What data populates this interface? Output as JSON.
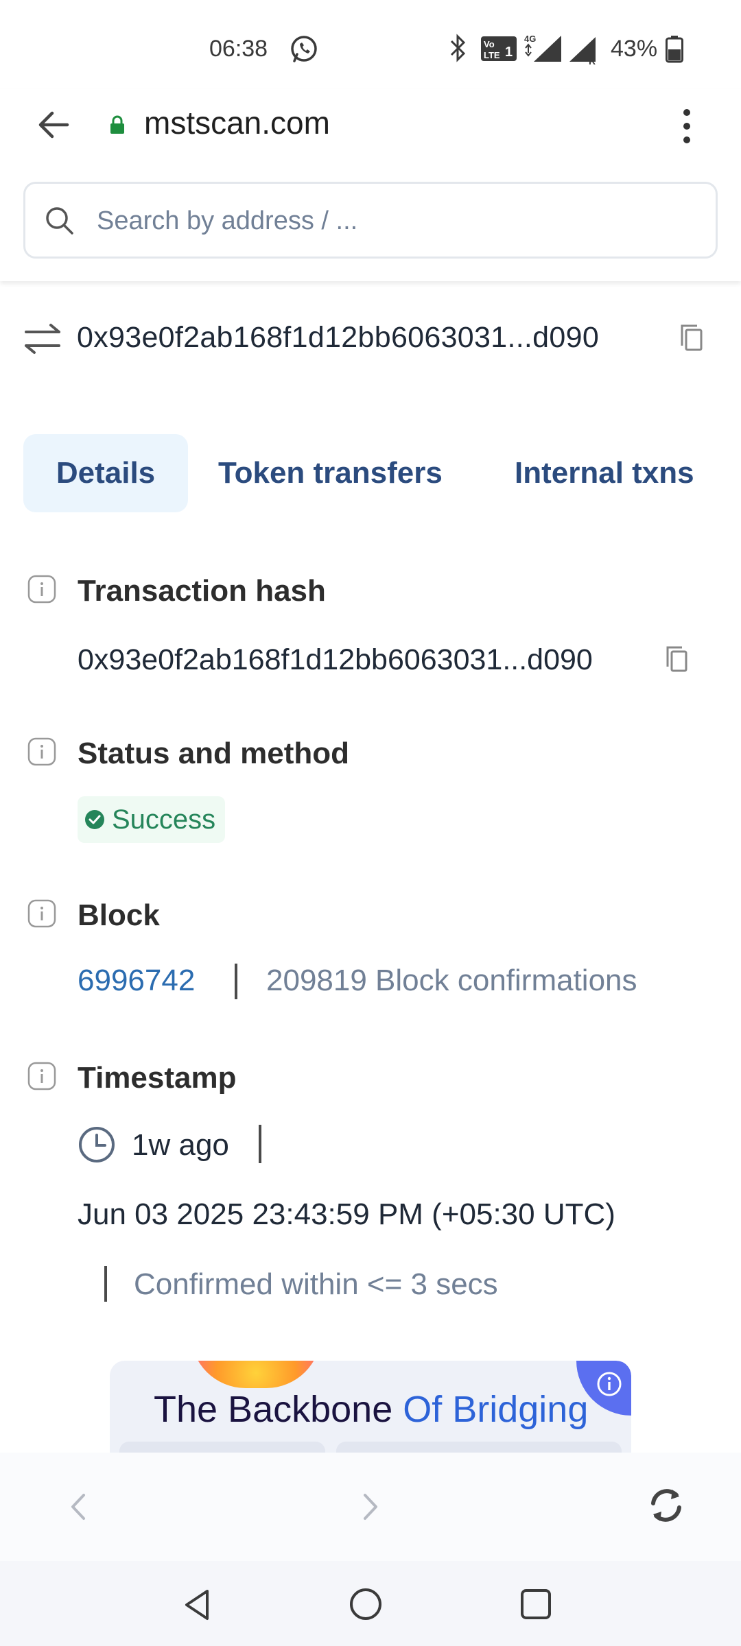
{
  "status_bar": {
    "time": "06:38",
    "battery": "43%",
    "icons": [
      "whatsapp-icon",
      "bluetooth-icon",
      "volte-icon",
      "signal-4g-icon",
      "signal-roaming-icon",
      "battery-icon"
    ]
  },
  "browser": {
    "url": "mstscan.com",
    "search_placeholder": "Search by address / ..."
  },
  "transaction": {
    "hash_short": "0x93e0f2ab168f1d12bb6063031...d090"
  },
  "tabs": [
    {
      "label": "Details",
      "active": true
    },
    {
      "label": "Token transfers",
      "active": false
    },
    {
      "label": "Internal txns",
      "active": false
    }
  ],
  "details": {
    "tx_hash_label": "Transaction hash",
    "tx_hash_value": "0x93e0f2ab168f1d12bb6063031...d090",
    "status_label": "Status and method",
    "status_value": "Success",
    "block_label": "Block",
    "block_number": "6996742",
    "block_confirmations": "209819 Block confirmations",
    "timestamp_label": "Timestamp",
    "timestamp_ago": "1w ago",
    "timestamp_full": "Jun 03 2025 23:43:59 PM (+05:30 UTC)",
    "confirmed_within": "Confirmed within <= 3 secs"
  },
  "ad": {
    "title_part1": "The Backbone ",
    "title_part2": "Of Bridging"
  },
  "colors": {
    "link": "#2b6cb0",
    "tab_text": "#2b4b7e",
    "tab_active_bg": "#ebf5fd",
    "success": "#25855a",
    "success_bg": "#effaf3",
    "muted": "#718096"
  }
}
